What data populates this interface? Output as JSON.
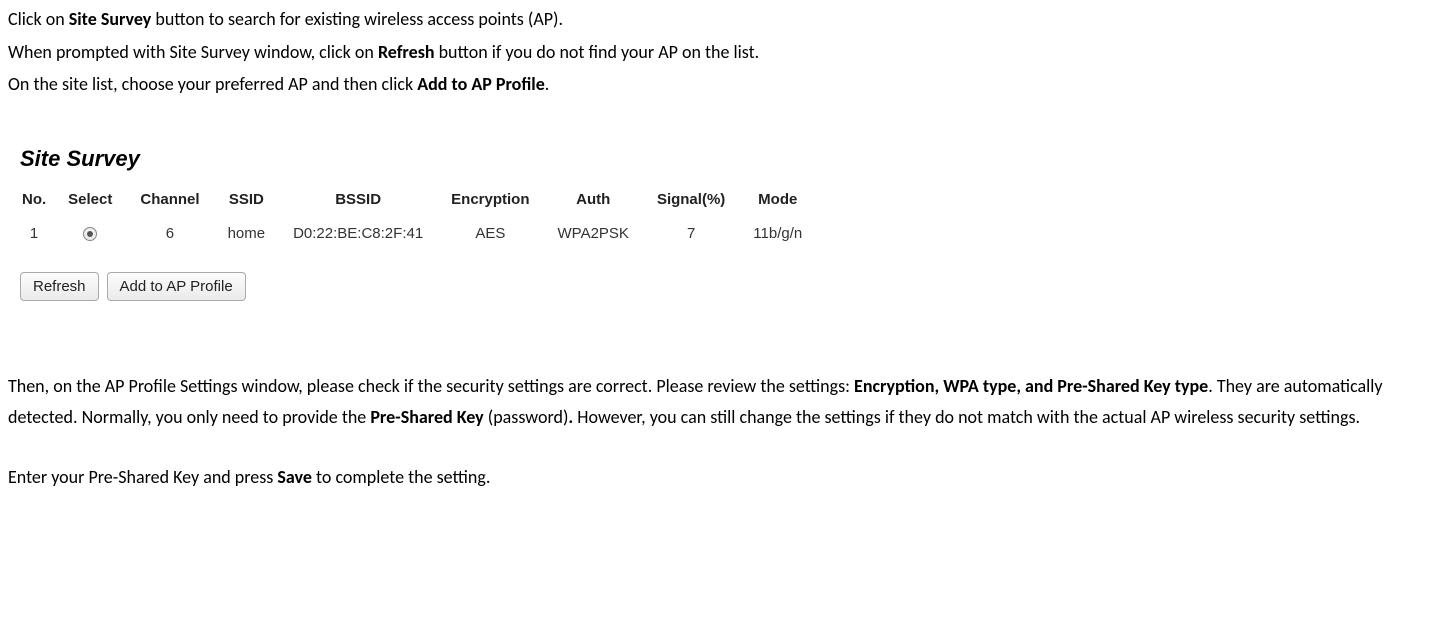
{
  "intro": {
    "p1_a": "Click on ",
    "p1_b": "Site Survey",
    "p1_c": " button to search for existing wireless access points (AP).",
    "p2_a": "When prompted with Site Survey window, click on ",
    "p2_b": "Refresh",
    "p2_c": " button if you do not find your AP on the list.",
    "p3_a": "On the site list, choose your preferred AP and then click ",
    "p3_b": "Add to AP Profile",
    "p3_c": "."
  },
  "survey": {
    "title": "Site Survey",
    "headers": {
      "no": "No.",
      "select": "Select",
      "channel": "Channel",
      "ssid": "SSID",
      "bssid": "BSSID",
      "encryption": "Encryption",
      "auth": "Auth",
      "signal": "Signal(%)",
      "mode": "Mode"
    },
    "rows": [
      {
        "no": "1",
        "channel": "6",
        "ssid": "home",
        "bssid": "D0:22:BE:C8:2F:41",
        "encryption": "AES",
        "auth": "WPA2PSK",
        "signal": "7",
        "mode": "11b/g/n"
      }
    ],
    "buttons": {
      "refresh": "Refresh",
      "add": "Add to AP Profile"
    }
  },
  "outro": {
    "p1_a": "Then, on the AP Profile Settings window, please check if the security settings are correct. Please review the settings: ",
    "p1_b": "Encryption, WPA type, and Pre-Shared Key type",
    "p1_c": ". They are automatically detected. Normally, you only need to provide the ",
    "p1_d": "Pre-Shared Key",
    "p1_e": " (password)",
    "p1_f": ".",
    "p1_g": " However, you can still change the settings if they do not match with the actual AP wireless security settings.",
    "p2_a": "Enter your Pre-Shared Key and press ",
    "p2_b": "Save",
    "p2_c": " to complete the setting."
  }
}
